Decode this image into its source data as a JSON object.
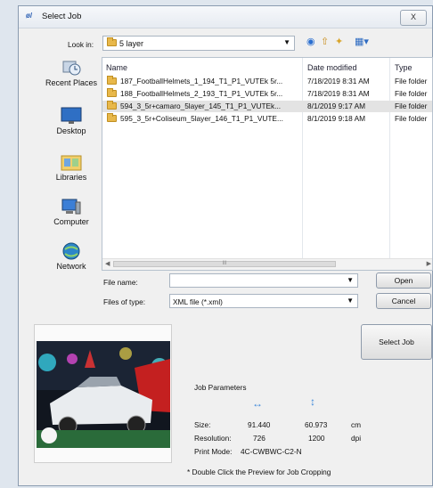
{
  "window": {
    "title": "Select Job",
    "close_label": "X"
  },
  "lookin": {
    "label": "Look in:",
    "value": "5 layer"
  },
  "places": [
    {
      "label": "Recent Places",
      "icon": "recent-places-icon"
    },
    {
      "label": "Desktop",
      "icon": "desktop-icon"
    },
    {
      "label": "Libraries",
      "icon": "libraries-icon"
    },
    {
      "label": "Computer",
      "icon": "computer-icon"
    },
    {
      "label": "Network",
      "icon": "network-icon"
    }
  ],
  "columns": {
    "name": "Name",
    "date": "Date modified",
    "type": "Type"
  },
  "files": [
    {
      "name": "187_FootballHelmets_1_194_T1_P1_VUTEk 5r...",
      "date": "7/18/2019 8:31 AM",
      "type": "File folder"
    },
    {
      "name": "188_FootballHelmets_2_193_T1_P1_VUTEk 5r...",
      "date": "7/18/2019 8:31 AM",
      "type": "File folder"
    },
    {
      "name": "594_3_5r+camaro_5layer_145_T1_P1_VUTEk...",
      "date": "8/1/2019 9:17 AM",
      "type": "File folder"
    },
    {
      "name": "595_3_5r+Coliseum_5layer_146_T1_P1_VUTE...",
      "date": "8/1/2019 9:18 AM",
      "type": "File folder"
    }
  ],
  "file_name": {
    "label": "File name:",
    "value": ""
  },
  "file_type": {
    "label": "Files of type:",
    "value": "XML file (*.xml)"
  },
  "buttons": {
    "open": "Open",
    "cancel": "Cancel",
    "select_job": "Select Job"
  },
  "params": {
    "title": "Job Parameters",
    "size_label": "Size:",
    "width": "91.440",
    "height": "60.973",
    "size_unit": "cm",
    "res_label": "Resolution:",
    "res_x": "726",
    "res_y": "1200",
    "res_unit": "dpi",
    "mode_label": "Print Mode:",
    "mode_value": "4C-CWBWC-C2-N"
  },
  "note": "* Double Click the Preview for Job Cropping",
  "scroll_thumb_label": "III",
  "colors": {
    "folder": "#e8b84a",
    "accent": "#3a86d8"
  }
}
